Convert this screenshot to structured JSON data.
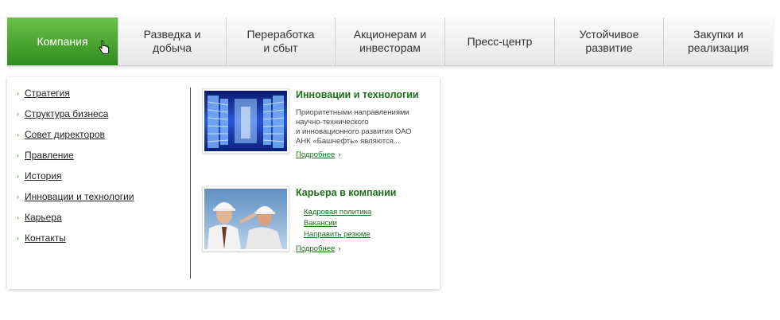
{
  "nav": {
    "items": [
      {
        "label": "Компания",
        "active": true
      },
      {
        "label": "Разведка и\nдобыча"
      },
      {
        "label": "Переработка\nи сбыт"
      },
      {
        "label": "Акционерам и\nинвесторам"
      },
      {
        "label": "Пресс-центр"
      },
      {
        "label": "Устойчивое\nразвитие"
      },
      {
        "label": "Закупки и\nреализация"
      }
    ]
  },
  "menu": {
    "items": [
      {
        "label": "Стратегия"
      },
      {
        "label": "Структура бизнеса"
      },
      {
        "label": "Совет директоров"
      },
      {
        "label": "Правление"
      },
      {
        "label": "История"
      },
      {
        "label": "Инновации и технологии"
      },
      {
        "label": "Карьера"
      },
      {
        "label": "Контакты"
      }
    ],
    "bullet": "›"
  },
  "cards": [
    {
      "title": "Инновации и технологии",
      "text": "Приоритетными направлениями\nнаучно-технического\nи инновационного развития ОАО\nАНК «Башнефть» являются...",
      "more": "Подробнее",
      "image": "server-room-image"
    },
    {
      "title": "Карьера в компании",
      "links": [
        {
          "label": "Кадровая политика"
        },
        {
          "label": "Вакансии"
        },
        {
          "label": "Направить резюме"
        }
      ],
      "more": "Подробнее",
      "image": "engineers-in-hardhats-image"
    }
  ],
  "more_arrow": "›",
  "colors": {
    "active_tab_top": "#6cc248",
    "active_tab_bottom": "#2f8b1f",
    "link_green": "#1d6f1b",
    "bullet_green": "#3a9a2a"
  }
}
